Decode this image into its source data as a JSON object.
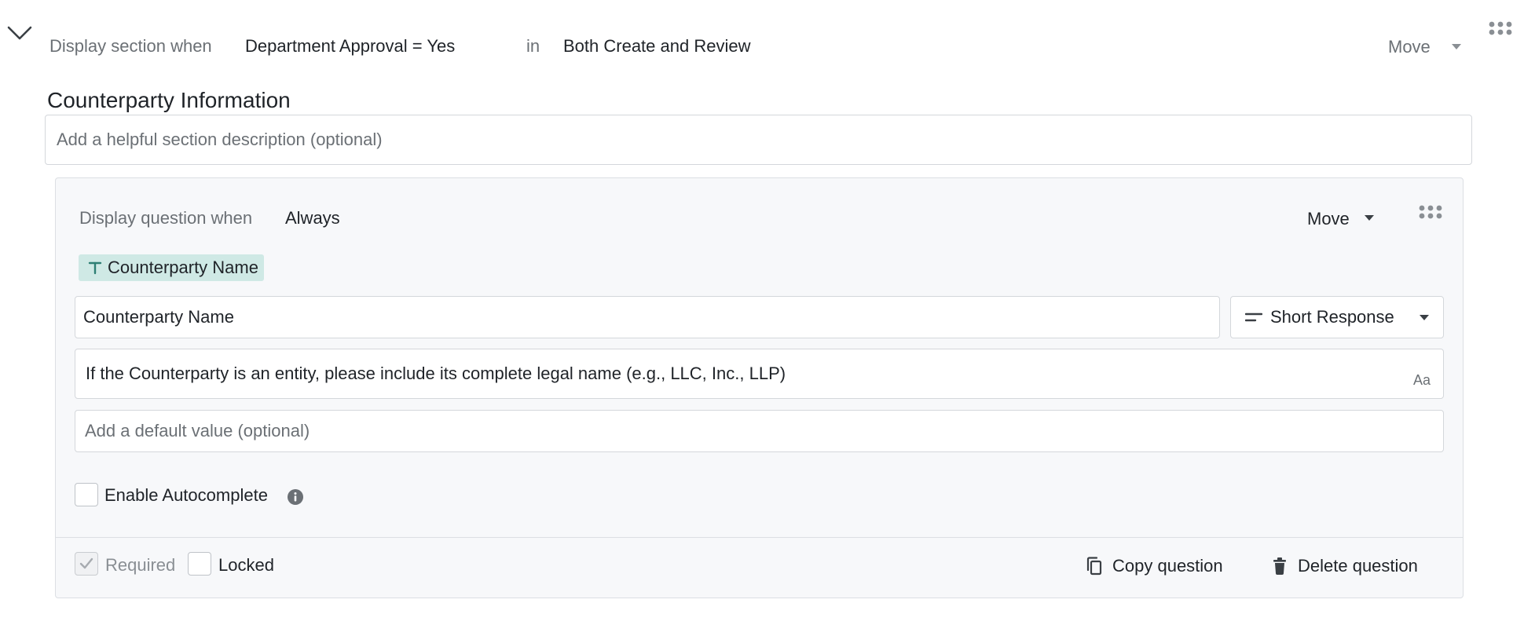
{
  "section": {
    "display_label": "Display section when",
    "condition": "Department Approval = Yes",
    "in_label": "in",
    "scope": "Both Create and Review",
    "move_label": "Move",
    "title": "Counterparty Information",
    "description_placeholder": "Add a helpful section description (optional)"
  },
  "question": {
    "display_label": "Display question when",
    "condition": "Always",
    "move_label": "Move",
    "tag_label": "Counterparty Name",
    "name_value": "Counterparty Name",
    "response_type": "Short Response",
    "help_text": "If the Counterparty is an entity, please include its complete legal name (e.g., LLC, Inc., LLP)",
    "format_toggle": "Aa",
    "default_placeholder": "Add a default value (optional)",
    "autocomplete_label": "Enable Autocomplete",
    "required_label": "Required",
    "locked_label": "Locked",
    "copy_label": "Copy question",
    "delete_label": "Delete question"
  },
  "state": {
    "required_checked": true,
    "locked_checked": false,
    "autocomplete_checked": false
  },
  "icons": {
    "collapse": "chevron-down-icon",
    "grip": "grip-dots-icon",
    "tag": "text-type-icon",
    "response": "short-text-icon",
    "info": "info-icon",
    "copy": "copy-icon",
    "delete": "trash-icon",
    "check": "check-icon"
  },
  "colors": {
    "tag_background": "#cfe9e5",
    "tag_icon": "#2e7f74",
    "card_background": "#f7f8fa"
  }
}
